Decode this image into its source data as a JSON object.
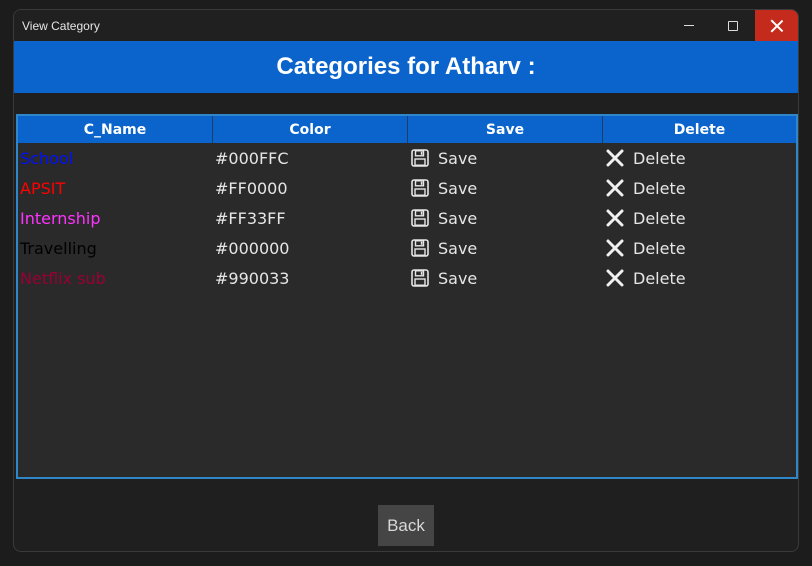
{
  "window": {
    "title": "View Category"
  },
  "header": {
    "title": "Categories for Atharv :"
  },
  "table": {
    "columns": [
      "C_Name",
      "Color",
      "Save",
      "Delete"
    ],
    "rows": [
      {
        "name": "School",
        "color": "#000FFC",
        "save": "Save",
        "delete": "Delete"
      },
      {
        "name": "APSIT",
        "color": "#FF0000",
        "save": "Save",
        "delete": "Delete"
      },
      {
        "name": "Internship",
        "color": "#FF33FF",
        "save": "Save",
        "delete": "Delete"
      },
      {
        "name": "Travelling",
        "color": "#000000",
        "save": "Save",
        "delete": "Delete"
      },
      {
        "name": "Netflix sub",
        "color": "#990033",
        "save": "Save",
        "delete": "Delete"
      }
    ]
  },
  "footer": {
    "back_label": "Back"
  },
  "icons": {
    "save": "floppy-disk-icon",
    "delete": "close-x-icon"
  },
  "theme": {
    "accent": "#0A64CC",
    "close": "#C42B1C",
    "grid_border": "#2F86C8"
  }
}
